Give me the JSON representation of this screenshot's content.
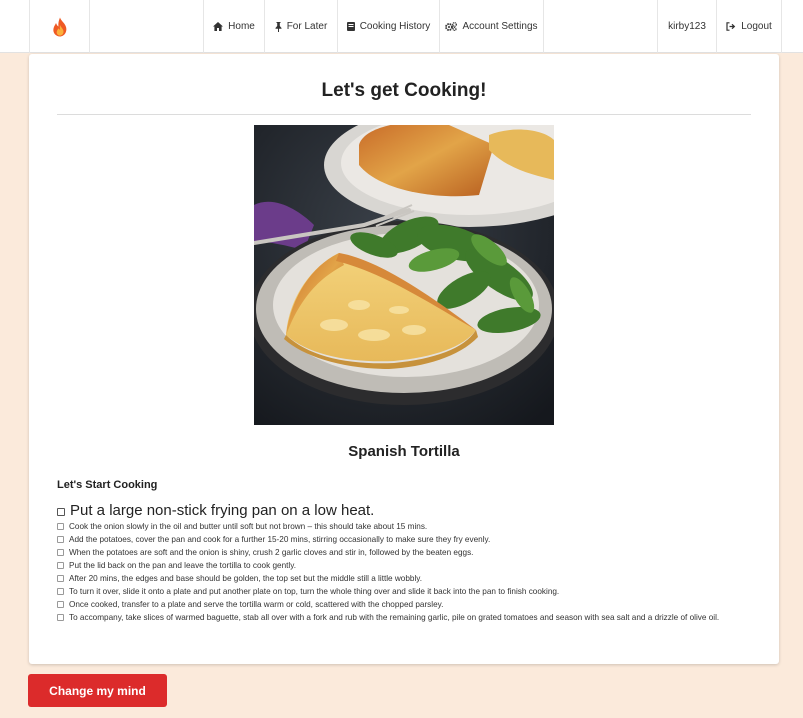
{
  "navbar": {
    "brand_icon": "flame-icon",
    "items": [
      {
        "label": "Home",
        "icon": "home-icon"
      },
      {
        "label": "For Later",
        "icon": "pin-icon"
      },
      {
        "label": "Cooking History",
        "icon": "book-icon"
      },
      {
        "label": "Account Settings",
        "icon": "gears-icon"
      }
    ],
    "username": "kirby123",
    "logout_label": "Logout",
    "logout_icon": "sign-out-icon"
  },
  "main": {
    "title": "Let's get Cooking!",
    "recipe_name": "Spanish Tortilla",
    "section_label": "Let's Start Cooking",
    "steps": [
      "Put a large non-stick frying pan on a low heat.",
      "Cook the onion slowly in the oil and butter until soft but not brown – this should take about 15 mins.",
      "Add the potatoes, cover the pan and cook for a further 15-20 mins, stirring occasionally to make sure they fry evenly.",
      "When the potatoes are soft and the onion is shiny, crush 2 garlic cloves and stir in, followed by the beaten eggs.",
      "Put the lid back on the pan and leave the tortilla to cook gently.",
      "After 20 mins, the edges and base should be golden, the top set but the middle still a little wobbly.",
      "To turn it over, slide it onto a plate and put another plate on top, turn the whole thing over and slide it back into the pan to finish cooking.",
      "Once cooked, transfer to a plate and serve the tortilla warm or cold, scattered with the chopped parsley.",
      "To accompany, take slices of warmed baguette, stab all over with a fork and rub with the remaining garlic, pile on grated tomatoes and season with sea salt and a drizzle of olive oil."
    ]
  },
  "actions": {
    "change_label": "Change my mind"
  },
  "colors": {
    "page_background": "#fbeadb",
    "button_red": "#dc2b2b",
    "brand_flame": "#f0592a"
  }
}
